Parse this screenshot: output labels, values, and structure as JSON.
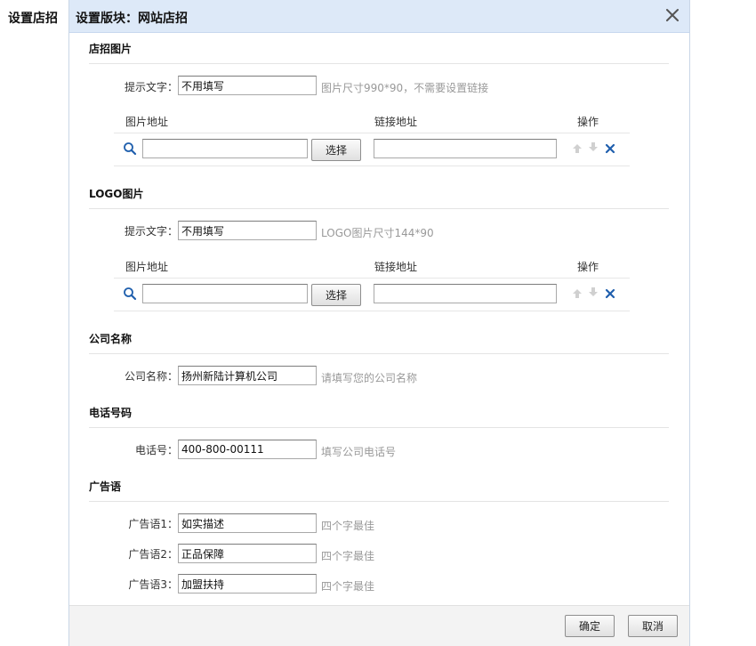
{
  "page_heading": "设置店招",
  "dialog": {
    "title": "设置版块：网站店招"
  },
  "sign_image": {
    "section_title": "店招图片",
    "hint_label": "提示文字：",
    "hint_value": "不用填写",
    "hint_note": "图片尺寸990*90，不需要设置链接",
    "col_image": "图片地址",
    "col_link": "链接地址",
    "col_action": "操作",
    "image_url": "",
    "link_url": "",
    "choose_label": "选择"
  },
  "logo_image": {
    "section_title": "LOGO图片",
    "hint_label": "提示文字：",
    "hint_value": "不用填写",
    "hint_note": "LOGO图片尺寸144*90",
    "col_image": "图片地址",
    "col_link": "链接地址",
    "col_action": "操作",
    "image_url": "",
    "link_url": "",
    "choose_label": "选择"
  },
  "company": {
    "section_title": "公司名称",
    "label": "公司名称：",
    "value": "扬州新陆计算机公司",
    "hint": "请填写您的公司名称"
  },
  "phone": {
    "section_title": "电话号码",
    "label": "电话号：",
    "value": "400-800-00111",
    "hint": "填写公司电话号"
  },
  "slogans": {
    "section_title": "广告语",
    "items": [
      {
        "label": "广告语1：",
        "value": "如实描述",
        "hint": "四个字最佳"
      },
      {
        "label": "广告语2：",
        "value": "正品保障",
        "hint": "四个字最佳"
      },
      {
        "label": "广告语3：",
        "value": "加盟扶持",
        "hint": "四个字最佳"
      }
    ]
  },
  "footer": {
    "ok_label": "确定",
    "cancel_label": "取消"
  },
  "colors": {
    "header_bg": "#dde9f8",
    "link_blue": "#1f5fad",
    "hint_gray": "#999999"
  },
  "icons": [
    "close-icon",
    "search-icon",
    "arrow-up-icon",
    "arrow-down-icon",
    "delete-icon"
  ]
}
